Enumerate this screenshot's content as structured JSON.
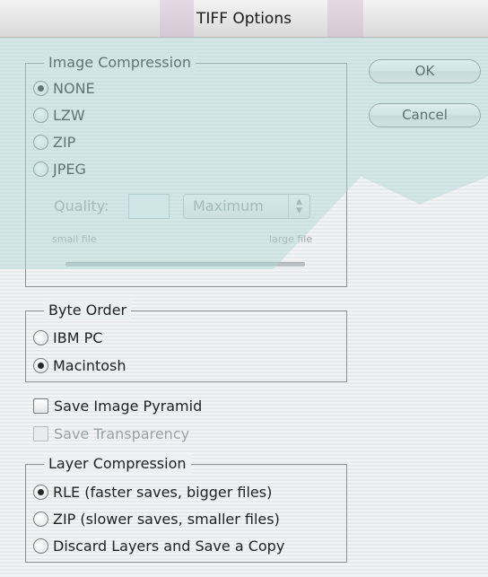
{
  "window": {
    "title": "TIFF Options"
  },
  "image_compression": {
    "title": "Image Compression",
    "options": [
      {
        "label": "NONE",
        "selected": true
      },
      {
        "label": "LZW",
        "selected": false
      },
      {
        "label": "ZIP",
        "selected": false
      },
      {
        "label": "JPEG",
        "selected": false
      }
    ],
    "quality_label": "Quality:",
    "quality_value": "",
    "quality_select": "Maximum",
    "small_file_label": "small file",
    "large_file_label": "large file"
  },
  "byte_order": {
    "title": "Byte Order",
    "options": [
      {
        "label": "IBM PC",
        "selected": false
      },
      {
        "label": "Macintosh",
        "selected": true
      }
    ]
  },
  "checkboxes": {
    "save_image_pyramid": {
      "label": "Save Image Pyramid",
      "checked": false,
      "enabled": true
    },
    "save_transparency": {
      "label": "Save Transparency",
      "checked": false,
      "enabled": false
    }
  },
  "layer_compression": {
    "title": "Layer Compression",
    "options": [
      {
        "label": "RLE (faster saves, bigger files)",
        "selected": true
      },
      {
        "label": "ZIP (slower saves, smaller files)",
        "selected": false
      },
      {
        "label": "Discard Layers and Save a Copy",
        "selected": false
      }
    ]
  },
  "buttons": {
    "ok": "OK",
    "cancel": "Cancel"
  },
  "colors": {
    "watermark": "#afd6d8",
    "background": "#eef0f1",
    "disabled_text": "#9aa2a4"
  }
}
